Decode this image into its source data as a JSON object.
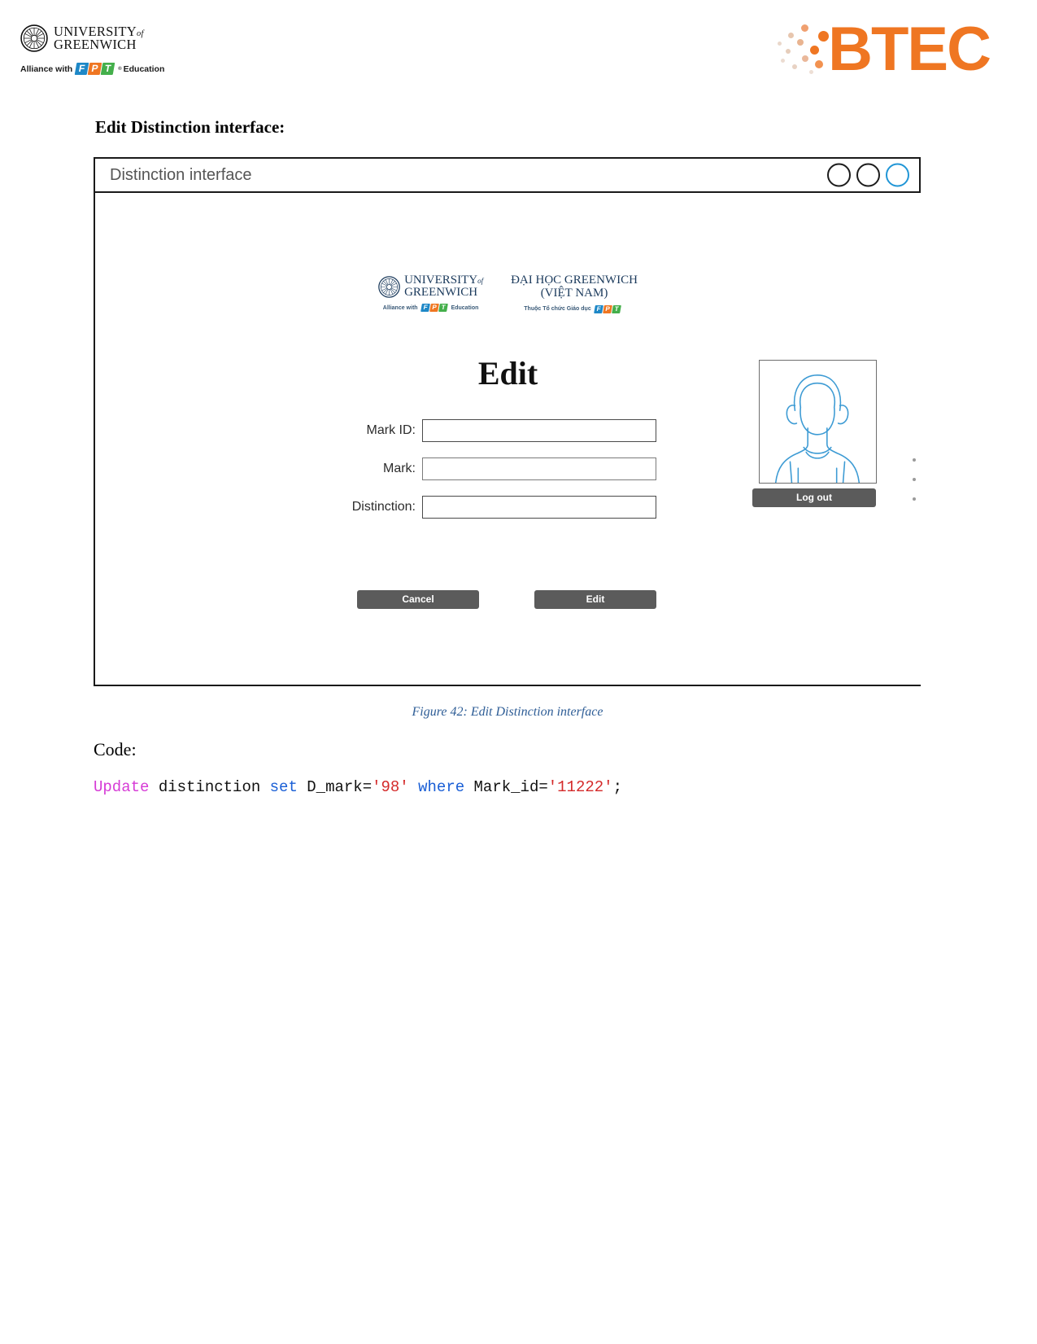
{
  "header": {
    "university": {
      "line1": "UNIVERSITY",
      "line1_suffix": "of",
      "line2": "GREENWICH",
      "seal_icon": "compass-rose-seal-icon"
    },
    "alliance": {
      "prefix": "Alliance with",
      "fpt_letters": [
        "F",
        "P",
        "T"
      ],
      "registered": "®",
      "suffix": "Education"
    },
    "btec": {
      "wordmark": "BTEC",
      "accent_color": "#ef7622",
      "dots_icon": "btec-dot-cluster-icon"
    }
  },
  "document": {
    "section_heading": "Edit Distinction interface:",
    "figure_caption": "Figure 42: Edit Distinction interface",
    "code_heading": "Code:",
    "code": {
      "tokens": [
        {
          "text": "Update",
          "type": "keyword-pink"
        },
        {
          "text": " distinction ",
          "type": "plain"
        },
        {
          "text": "set",
          "type": "keyword-blue"
        },
        {
          "text": " D_mark=",
          "type": "plain"
        },
        {
          "text": "'98'",
          "type": "string"
        },
        {
          "text": " ",
          "type": "plain"
        },
        {
          "text": "where",
          "type": "keyword-blue"
        },
        {
          "text": " Mark_id=",
          "type": "plain"
        },
        {
          "text": "'11222'",
          "type": "string"
        },
        {
          "text": ";",
          "type": "plain"
        }
      ],
      "full_text": "Update distinction set D_mark='98' where Mark_id='11222';"
    }
  },
  "window": {
    "title": "Distinction interface",
    "controls": [
      {
        "name": "minimize",
        "active": false
      },
      {
        "name": "maximize",
        "active": false
      },
      {
        "name": "close",
        "active": true
      }
    ],
    "app": {
      "logo_left": {
        "line1": "UNIVERSITY",
        "line1_suffix": "of",
        "line2": "GREENWICH",
        "sub_prefix": "Alliance with",
        "sub_suffix": "Education"
      },
      "logo_right": {
        "line1": "ĐẠI HỌC GREENWICH",
        "line2": "(VIỆT NAM)",
        "sub_prefix": "Thuộc Tổ chức Giáo dục"
      },
      "title": "Edit",
      "fields": [
        {
          "label": "Mark ID:",
          "value": "",
          "placeholder": ""
        },
        {
          "label": "Mark:",
          "value": "",
          "placeholder": ""
        },
        {
          "label": "Distinction:",
          "value": "",
          "placeholder": ""
        }
      ],
      "buttons": {
        "cancel": "Cancel",
        "submit": "Edit",
        "logout": "Log out"
      },
      "avatar_icon": "user-portrait-icon"
    }
  }
}
